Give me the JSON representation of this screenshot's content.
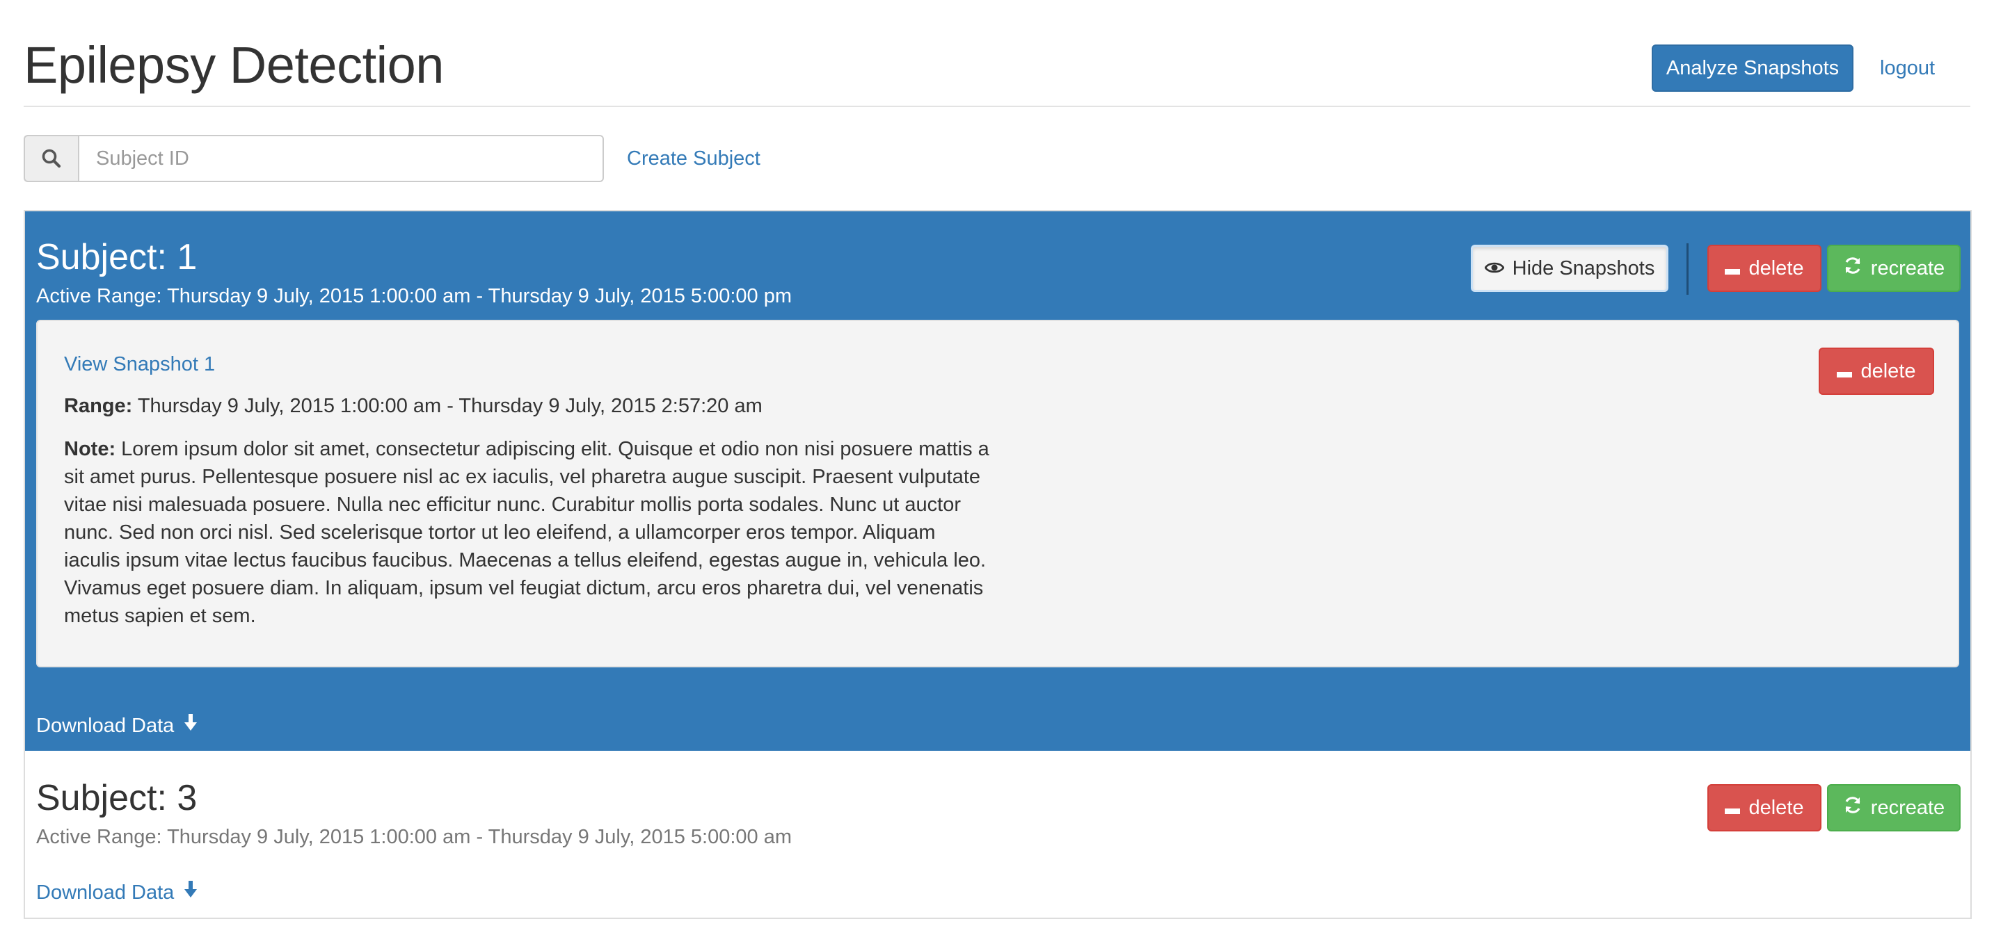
{
  "header": {
    "title": "Epilepsy Detection",
    "analyze_label": "Analyze Snapshots",
    "logout_label": "logout"
  },
  "search": {
    "placeholder": "Subject ID",
    "create_label": "Create Subject"
  },
  "subjects": [
    {
      "title": "Subject: 1",
      "active_range": "Active Range: Thursday 9 July, 2015 1:00:00 am - Thursday 9 July, 2015 5:00:00 pm",
      "hide_snapshots_label": "Hide Snapshots",
      "delete_label": "delete",
      "recreate_label": "recreate",
      "download_label": "Download Data",
      "snapshots": [
        {
          "view_label": "View Snapshot 1",
          "range_label": "Range:",
          "range_value": " Thursday 9 July, 2015 1:00:00 am - Thursday 9 July, 2015 2:57:20 am",
          "note_label": "Note:",
          "note_value": " Lorem ipsum dolor sit amet, consectetur adipiscing elit. Quisque et odio non nisi posuere mattis a sit amet purus. Pellentesque posuere nisl ac ex iaculis, vel pharetra augue suscipit. Praesent vulputate vitae nisi malesuada posuere. Nulla nec efficitur nunc. Curabitur mollis porta sodales. Nunc ut auctor nunc. Sed non orci nisl. Sed scelerisque tortor ut leo eleifend, a ullamcorper eros tempor. Aliquam iaculis ipsum vitae lectus faucibus faucibus. Maecenas a tellus eleifend, egestas augue in, vehicula leo. Vivamus eget posuere diam. In aliquam, ipsum vel feugiat dictum, arcu eros pharetra dui, vel venenatis metus sapien et sem.",
          "delete_label": "delete"
        }
      ]
    },
    {
      "title": "Subject: 3",
      "active_range": "Active Range: Thursday 9 July, 2015 1:00:00 am - Thursday 9 July, 2015 5:00:00 am",
      "delete_label": "delete",
      "recreate_label": "recreate",
      "download_label": "Download Data"
    }
  ],
  "icons": {
    "search": "search-icon",
    "eye": "eye-icon",
    "minus": "minus-icon",
    "refresh": "refresh-icon",
    "download": "download-arrow-icon"
  },
  "colors": {
    "primary": "#337ab7",
    "danger": "#d9534f",
    "success": "#5cb85c",
    "panel_bg": "#f4f4f4"
  }
}
